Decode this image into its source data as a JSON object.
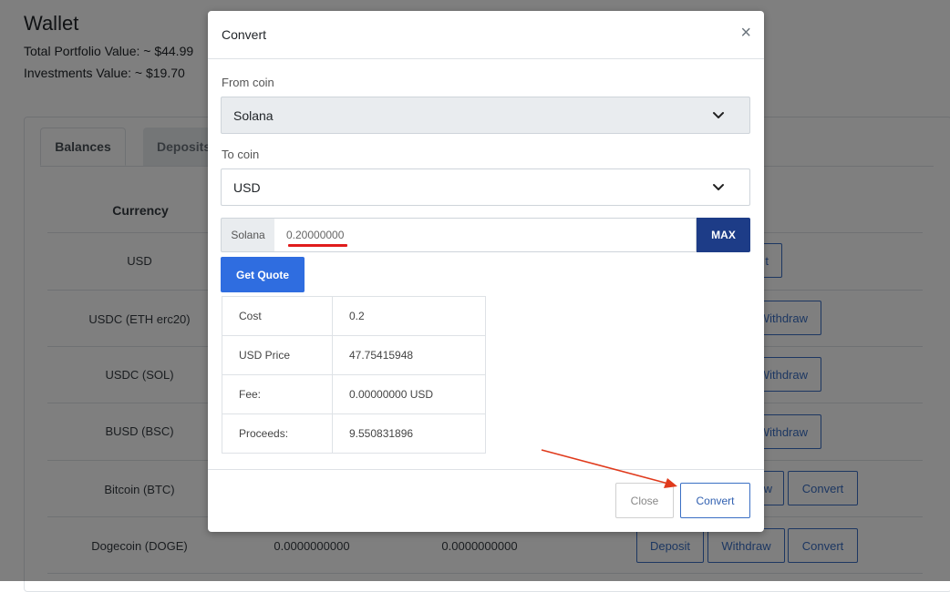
{
  "page": {
    "title": "Wallet",
    "total_portfolio": "Total Portfolio Value: ~ $44.99",
    "investments": "Investments Value: ~ $19.70",
    "tabs": [
      "Balances",
      "Deposits"
    ],
    "table_header": "Currency",
    "rows": [
      {
        "currency": "USD"
      },
      {
        "currency": "USDC (ETH erc20)"
      },
      {
        "currency": "USDC (SOL)"
      },
      {
        "currency": "BUSD (BSC)"
      },
      {
        "currency": "Bitcoin (BTC)"
      },
      {
        "currency": "Dogecoin (DOGE)",
        "amount1": "0.0000000000",
        "amount2": "0.0000000000"
      }
    ],
    "buttons": {
      "deposit": "Deposit",
      "withdraw": "Withdraw",
      "convert": "Convert",
      "partial_t": "t",
      "partial_w": "w",
      "partial_withdraw": "Withdraw"
    }
  },
  "modal": {
    "title": "Convert",
    "close_symbol": "×",
    "from_label": "From coin",
    "from_value": "Solana",
    "to_label": "To coin",
    "to_value": "USD",
    "amount_prefix": "Solana",
    "amount_value": "0.20000000",
    "max_label": "MAX",
    "quote_label": "Get Quote",
    "quote": [
      {
        "key": "Cost",
        "value": "0.2"
      },
      {
        "key": "USD Price",
        "value": "47.75415948"
      },
      {
        "key": "Fee:",
        "value": "0.00000000 USD"
      },
      {
        "key": "Proceeds:",
        "value": "9.550831896"
      }
    ],
    "close_label": "Close",
    "convert_label": "Convert"
  },
  "colors": {
    "primary": "#2f6de0",
    "dark_primary": "#1d3c87",
    "annotation": "#e03a1c"
  }
}
